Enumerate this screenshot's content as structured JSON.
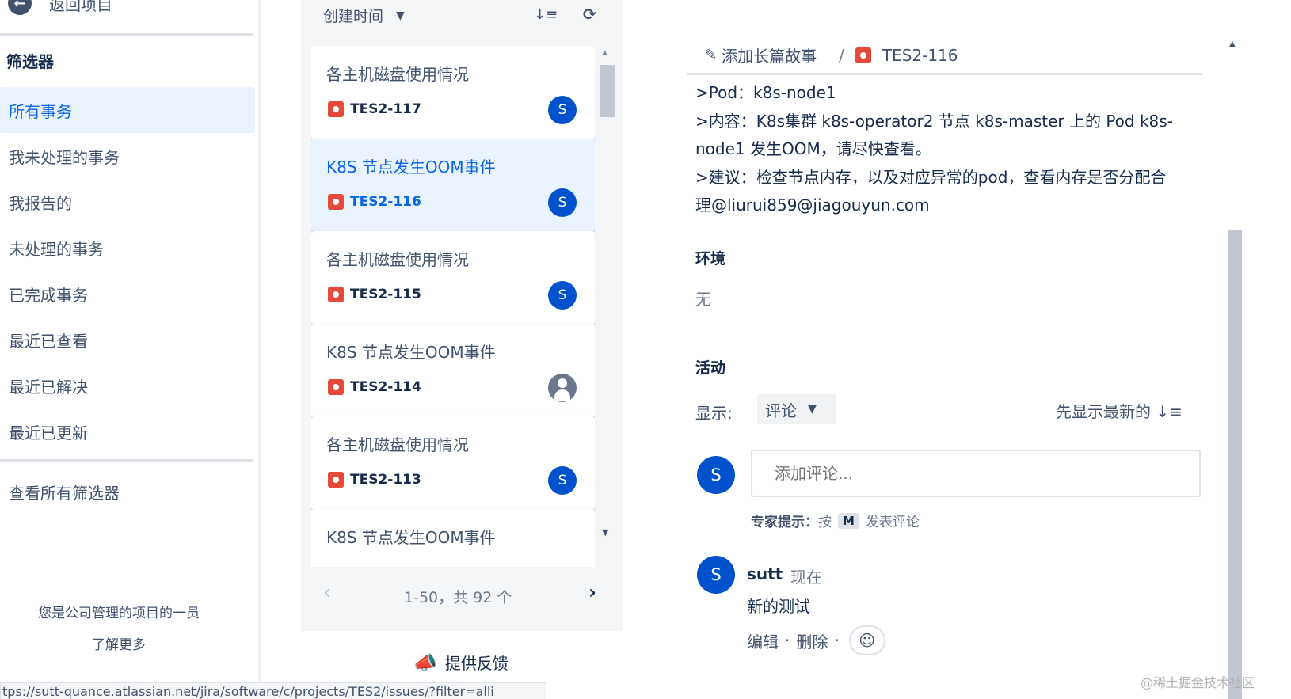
{
  "sidebar": {
    "back_label": "返回项目",
    "filter_title": "筛选器",
    "items": [
      {
        "label": "所有事务",
        "active": true
      },
      {
        "label": "我未处理的事务"
      },
      {
        "label": "我报告的"
      },
      {
        "label": "未处理的事务"
      },
      {
        "label": "已完成事务"
      },
      {
        "label": "最近已查看"
      },
      {
        "label": "最近已解决"
      },
      {
        "label": "最近已更新"
      }
    ],
    "view_all_filters": "查看所有筛选器",
    "footer_member": "您是公司管理的项目的一员",
    "footer_learn_more": "了解更多"
  },
  "status_url": "tps://sutt-quance.atlassian.net/jira/software/c/projects/TES2/issues/?filter=alli",
  "list": {
    "sort_label": "创建时间",
    "sort_icon": "sort-desc-icon",
    "refresh_icon": "refresh-icon",
    "cards": [
      {
        "title": "各主机磁盘使用情况",
        "key": "TES2-117",
        "assignee": "S"
      },
      {
        "title": "K8S 节点发生OOM事件",
        "key": "TES2-116",
        "assignee": "S",
        "selected": true
      },
      {
        "title": "各主机磁盘使用情况",
        "key": "TES2-115",
        "assignee": "S"
      },
      {
        "title": "K8S 节点发生OOM事件",
        "key": "TES2-114",
        "assignee": ""
      },
      {
        "title": "各主机磁盘使用情况",
        "key": "TES2-113",
        "assignee": "S"
      },
      {
        "title": "K8S 节点发生OOM事件",
        "key": "",
        "assignee": ""
      }
    ],
    "pager_text": "1-50，共 92 个",
    "feedback_label": "提供反馈"
  },
  "detail": {
    "breadcrumb_parent": "添加长篇故事",
    "breadcrumb_sep": "/",
    "breadcrumb_key": "TES2-116",
    "description_lines": [
      ">Pod：k8s-node1",
      ">内容：K8s集群 k8s-operator2 节点 k8s-master 上的 Pod k8s-",
      "node1 发生OOM，请尽快查看。",
      ">建议：检查节点内存，以及对应异常的pod，查看内存是否分配合",
      "理@liurui859@jiagouyun.com"
    ],
    "environment_heading": "环境",
    "environment_value": "无",
    "activity_heading": "活动",
    "show_label": "显示:",
    "show_value": "评论",
    "newest_first": "先显示最新的",
    "comment_placeholder": "添加评论...",
    "current_user_initial": "S",
    "tip_prefix": "专家提示：",
    "tip_press": "按",
    "tip_key": "M",
    "tip_suffix": "发表评论",
    "comment": {
      "initial": "S",
      "author": "sutt",
      "time": "现在",
      "body": "新的测试",
      "edit": "编辑",
      "delete": "删除"
    }
  },
  "watermark": "@稀土掘金技术社区",
  "colors": {
    "accent": "#0c66e4",
    "bug": "#e5493a",
    "avatar": "#0052cc",
    "selected_bg": "#e9f2ff"
  }
}
